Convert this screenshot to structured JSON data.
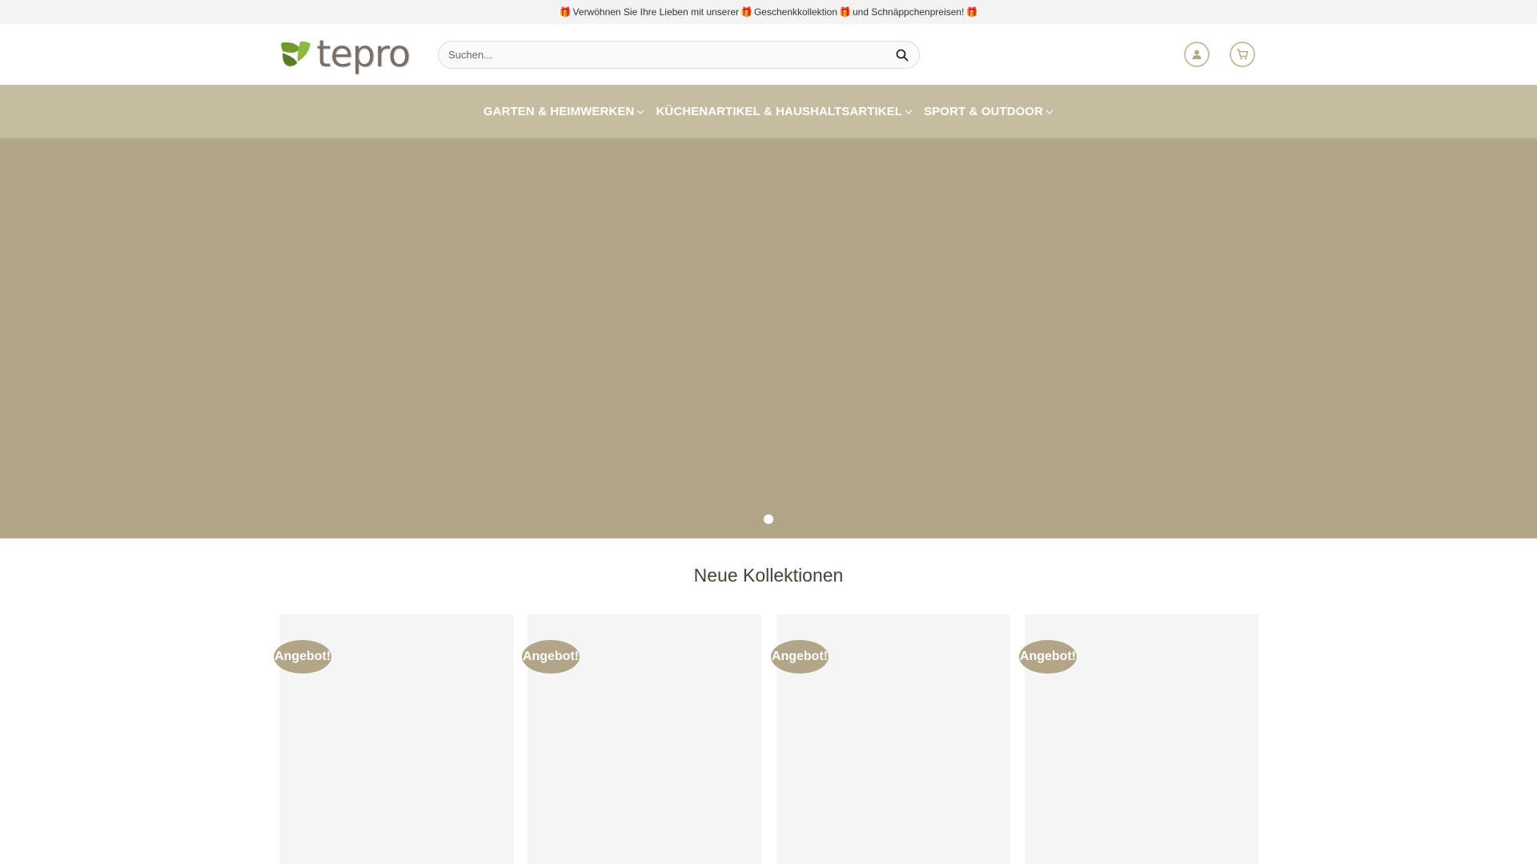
{
  "announcement": {
    "part1": "Verwöhnen Sie Ihre Lieben mit unserer",
    "part2": "Geschenkkollektion",
    "part3": "und Schnäppchenpreisen!"
  },
  "header": {
    "logo_text": "tepro",
    "search_placeholder": "Suchen..."
  },
  "nav": {
    "items": [
      {
        "label": "GARTEN & HEIMWERKEN"
      },
      {
        "label": "KÜCHENARTIKEL & HAUSHALTSARTIKEL"
      },
      {
        "label": "SPORT & OUTDOOR"
      }
    ]
  },
  "hero": {
    "slide_count": 1,
    "active_slide": 1
  },
  "section": {
    "title": "Neue Kollektionen"
  },
  "products": [
    {
      "badge": "Angebot!"
    },
    {
      "badge": "Angebot!"
    },
    {
      "badge": "Angebot!"
    },
    {
      "badge": "Angebot!"
    }
  ],
  "colors": {
    "nav_bg": "#c6bca2",
    "hero_bg": "#b3a688",
    "badge_bg": "#b3a688",
    "logo_green": "#7aa23a"
  }
}
